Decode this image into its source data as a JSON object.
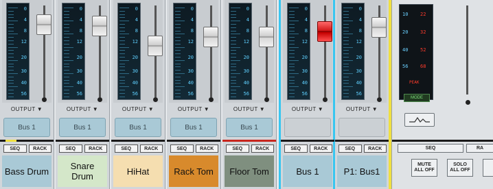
{
  "channels": [
    {
      "name": "Bass Drum",
      "output_label": "OUTPUT",
      "bus": "Bus 1",
      "seq": "SEQ",
      "rack": "RACK",
      "name_color": "#a9c9d6",
      "fader_level": 0.88,
      "selected": false
    },
    {
      "name": "Snare Drum",
      "output_label": "OUTPUT",
      "bus": "Bus 1",
      "seq": "SEQ",
      "rack": "RACK",
      "name_color": "#d4e7c9",
      "fader_level": 0.86,
      "selected": false
    },
    {
      "name": "HiHat",
      "output_label": "OUTPUT",
      "bus": "Bus 1",
      "seq": "SEQ",
      "rack": "RACK",
      "name_color": "#f5deb0",
      "fader_level": 0.6,
      "selected": false
    },
    {
      "name": "Rack Tom",
      "output_label": "OUTPUT",
      "bus": "Bus 1",
      "seq": "SEQ",
      "rack": "RACK",
      "name_color": "#d88a2c",
      "fader_level": 0.72,
      "selected": false
    },
    {
      "name": "Floor Tom",
      "output_label": "OUTPUT",
      "bus": "Bus 1",
      "seq": "SEQ",
      "rack": "RACK",
      "name_color": "#7f8f7f",
      "fader_level": 0.72,
      "selected": false
    },
    {
      "name": "Bus 1",
      "output_label": "OUTPUT",
      "bus": "",
      "seq": "SEQ",
      "rack": "RACK",
      "name_color": "#a9c9d6",
      "fader_level": 0.79,
      "selected": true
    },
    {
      "name": "P1: Bus1",
      "output_label": "OUTPUT",
      "bus": "",
      "seq": "SEQ",
      "rack": "RACK",
      "name_color": "#a9c9d6",
      "fader_level": 0.85,
      "selected": true
    }
  ],
  "meter_scale": [
    "0",
    "4",
    "8",
    "12",
    "20",
    "30",
    "40",
    "56"
  ],
  "master": {
    "peak_scale_left": [
      "10",
      "20",
      "40",
      "56"
    ],
    "peak_scale_right": [
      "22",
      "32",
      "52",
      "68"
    ],
    "peak_label": "PEAK",
    "mode_label": "MODE",
    "seq_label": "SEQ",
    "rack_label": "RA",
    "mute_label": "MUTE ALL OFF",
    "solo_label": "SOLO ALL OFF"
  },
  "colors": {
    "selected_border_cyan": "#38c6f0",
    "selected_border_yellow": "#f0e040",
    "peak_red": "#ff3b2b"
  }
}
